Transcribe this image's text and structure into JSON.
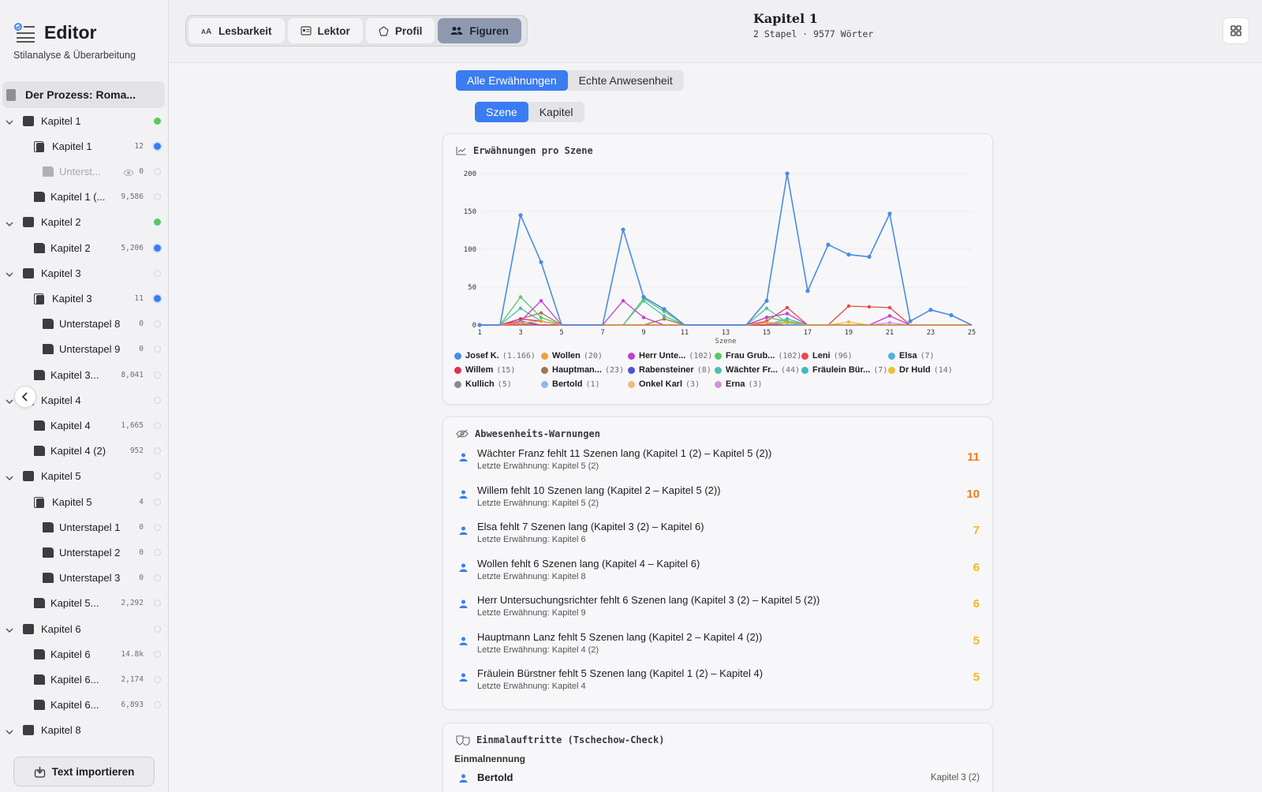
{
  "sidebar": {
    "title": "Editor",
    "subtitle": "Stilanalyse & Überarbeitung",
    "root": "Der Prozess: Roma...",
    "rows": [
      {
        "label": "Kapitel 1",
        "type": "folder",
        "level": 0,
        "count": "",
        "status": "green"
      },
      {
        "label": "Kapitel 1",
        "type": "stack",
        "level": 1,
        "count": "12",
        "status": "blue"
      },
      {
        "label": "Unterst...",
        "type": "subdoc-hidden",
        "level": 2,
        "count": "0",
        "status": "empty"
      },
      {
        "label": "Kapitel 1 (...",
        "type": "doc",
        "level": 1,
        "count": "9,586",
        "status": "empty"
      },
      {
        "label": "Kapitel 2",
        "type": "folder",
        "level": 0,
        "count": "",
        "status": "green"
      },
      {
        "label": "Kapitel 2",
        "type": "doc",
        "level": 1,
        "count": "5,206",
        "status": "blue"
      },
      {
        "label": "Kapitel 3",
        "type": "folder",
        "level": 0,
        "count": "",
        "status": "empty"
      },
      {
        "label": "Kapitel 3",
        "type": "stack",
        "level": 1,
        "count": "11",
        "status": "blue"
      },
      {
        "label": "Unterstapel 8",
        "type": "subdoc",
        "level": 2,
        "count": "0",
        "status": "empty"
      },
      {
        "label": "Unterstapel 9",
        "type": "subdoc",
        "level": 2,
        "count": "0",
        "status": "empty"
      },
      {
        "label": "Kapitel 3...",
        "type": "doc",
        "level": 1,
        "count": "8,041",
        "status": "empty"
      },
      {
        "label": "Kapitel 4",
        "type": "folder",
        "level": 0,
        "count": "",
        "status": "empty"
      },
      {
        "label": "Kapitel 4",
        "type": "doc",
        "level": 1,
        "count": "1,665",
        "status": "empty"
      },
      {
        "label": "Kapitel 4 (2)",
        "type": "doc",
        "level": 1,
        "count": "952",
        "status": "empty"
      },
      {
        "label": "Kapitel 5",
        "type": "folder",
        "level": 0,
        "count": "",
        "status": "empty"
      },
      {
        "label": "Kapitel 5",
        "type": "stack",
        "level": 1,
        "count": "4",
        "status": "empty"
      },
      {
        "label": "Unterstapel 1",
        "type": "subdoc",
        "level": 2,
        "count": "0",
        "status": "empty"
      },
      {
        "label": "Unterstapel 2",
        "type": "subdoc",
        "level": 2,
        "count": "0",
        "status": "empty"
      },
      {
        "label": "Unterstapel 3",
        "type": "subdoc",
        "level": 2,
        "count": "0",
        "status": "empty"
      },
      {
        "label": "Kapitel 5...",
        "type": "doc",
        "level": 1,
        "count": "2,292",
        "status": "empty"
      },
      {
        "label": "Kapitel 6",
        "type": "folder",
        "level": 0,
        "count": "",
        "status": "empty"
      },
      {
        "label": "Kapitel 6",
        "type": "doc",
        "level": 1,
        "count": "14.8k",
        "status": "empty"
      },
      {
        "label": "Kapitel 6...",
        "type": "doc",
        "level": 1,
        "count": "2,174",
        "status": "empty"
      },
      {
        "label": "Kapitel 6...",
        "type": "doc",
        "level": 1,
        "count": "6,893",
        "status": "empty"
      },
      {
        "label": "Kapitel 8",
        "type": "folder",
        "level": 0,
        "count": "",
        "status": "none"
      }
    ],
    "import_label": "Text importieren"
  },
  "topbar": {
    "tabs": [
      {
        "label": "Lesbarkeit",
        "icon": "text-size-icon",
        "active": false
      },
      {
        "label": "Lektor",
        "icon": "id-card-icon",
        "active": false
      },
      {
        "label": "Profil",
        "icon": "pentagon-icon",
        "active": false
      },
      {
        "label": "Figuren",
        "icon": "people-icon",
        "active": true
      }
    ],
    "doc_title": "Kapitel 1",
    "doc_meta": "2 Stapel · 9577 Wörter"
  },
  "filters": {
    "mode": [
      "Alle Erwähnungen",
      "Echte Anwesenheit"
    ],
    "scope": [
      "Szene",
      "Kapitel"
    ]
  },
  "mentions_card": {
    "title": "Erwähnungen pro Szene"
  },
  "chart_data": {
    "type": "line",
    "xlabel": "Szene",
    "ylabel": "",
    "x": [
      1,
      2,
      3,
      4,
      5,
      6,
      7,
      8,
      9,
      10,
      11,
      12,
      13,
      14,
      15,
      16,
      17,
      18,
      19,
      20,
      21,
      22,
      23,
      24,
      25
    ],
    "xticks": [
      1,
      3,
      5,
      7,
      9,
      11,
      13,
      15,
      17,
      19,
      21,
      23,
      25
    ],
    "yticks": [
      0,
      50,
      100,
      150,
      200
    ],
    "ylim": [
      0,
      200
    ],
    "series": [
      {
        "name": "Josef K.",
        "count": "(1.166)",
        "color": "#4a8be6",
        "values": [
          0,
          0,
          145,
          83,
          0,
          0,
          0,
          126,
          37,
          21,
          0,
          0,
          0,
          0,
          32,
          200,
          45,
          106,
          93,
          90,
          147,
          5,
          20,
          13,
          0
        ]
      },
      {
        "name": "Wollen",
        "count": "(20)",
        "color": "#f0a040",
        "values": [
          0,
          0,
          3,
          5,
          0,
          0,
          0,
          0,
          0,
          0,
          0,
          0,
          0,
          0,
          3,
          3,
          0,
          0,
          0,
          0,
          0,
          0,
          0,
          0,
          0
        ]
      },
      {
        "name": "Herr Unte...",
        "count": "(102)",
        "color": "#c040d0",
        "values": [
          0,
          0,
          5,
          32,
          0,
          0,
          0,
          32,
          10,
          0,
          0,
          0,
          0,
          0,
          10,
          15,
          0,
          0,
          0,
          0,
          12,
          0,
          0,
          0,
          0
        ]
      },
      {
        "name": "Frau Grub...",
        "count": "(102)",
        "color": "#5ac864",
        "values": [
          0,
          0,
          37,
          10,
          0,
          0,
          0,
          0,
          35,
          18,
          0,
          0,
          0,
          0,
          10,
          5,
          0,
          0,
          0,
          0,
          0,
          0,
          0,
          0,
          0
        ]
      },
      {
        "name": "Leni",
        "count": "(96)",
        "color": "#e84848",
        "values": [
          0,
          0,
          0,
          0,
          0,
          0,
          0,
          0,
          0,
          0,
          0,
          0,
          0,
          0,
          5,
          23,
          0,
          0,
          25,
          24,
          23,
          0,
          0,
          0,
          0
        ]
      },
      {
        "name": "Elsa",
        "count": "(7)",
        "color": "#50b0e0",
        "values": [
          0,
          0,
          0,
          0,
          0,
          0,
          0,
          0,
          0,
          0,
          0,
          0,
          0,
          0,
          3,
          0,
          0,
          0,
          0,
          0,
          0,
          0,
          0,
          0,
          0
        ]
      },
      {
        "name": "Willem",
        "count": "(15)",
        "color": "#e03050",
        "values": [
          0,
          0,
          8,
          5,
          0,
          0,
          0,
          0,
          0,
          0,
          0,
          0,
          0,
          0,
          0,
          0,
          0,
          0,
          0,
          0,
          0,
          0,
          0,
          0,
          0
        ]
      },
      {
        "name": "Hauptman...",
        "count": "(23)",
        "color": "#a07850",
        "values": [
          0,
          0,
          8,
          16,
          0,
          0,
          0,
          0,
          0,
          8,
          0,
          0,
          0,
          0,
          0,
          0,
          0,
          0,
          0,
          0,
          0,
          0,
          0,
          0,
          0
        ]
      },
      {
        "name": "Rabensteiner",
        "count": "(8)",
        "color": "#5050d0",
        "values": [
          0,
          0,
          5,
          0,
          0,
          0,
          0,
          0,
          0,
          0,
          0,
          0,
          0,
          0,
          0,
          0,
          0,
          0,
          0,
          0,
          0,
          0,
          0,
          0,
          0
        ]
      },
      {
        "name": "Wächter Fr...",
        "count": "(44)",
        "color": "#50c0a8",
        "values": [
          0,
          0,
          22,
          5,
          0,
          0,
          0,
          0,
          32,
          12,
          0,
          0,
          0,
          0,
          22,
          3,
          0,
          0,
          0,
          0,
          0,
          0,
          0,
          0,
          0
        ]
      },
      {
        "name": "Fräulein Bür...",
        "count": "(7)",
        "color": "#40b8c8",
        "values": [
          0,
          0,
          0,
          0,
          0,
          0,
          0,
          0,
          0,
          0,
          0,
          0,
          0,
          0,
          0,
          8,
          0,
          0,
          0,
          0,
          0,
          0,
          0,
          0,
          0
        ]
      },
      {
        "name": "Dr Huld",
        "count": "(14)",
        "color": "#f0c030",
        "values": [
          0,
          0,
          0,
          0,
          0,
          0,
          0,
          0,
          0,
          0,
          0,
          0,
          0,
          0,
          0,
          5,
          0,
          0,
          4,
          0,
          0,
          0,
          0,
          0,
          0
        ]
      },
      {
        "name": "Kullich",
        "count": "(5)",
        "color": "#8a8a8e",
        "values": [
          0,
          0,
          2,
          0,
          0,
          0,
          0,
          0,
          0,
          0,
          0,
          0,
          0,
          0,
          0,
          0,
          0,
          0,
          0,
          0,
          0,
          0,
          0,
          0,
          0
        ]
      },
      {
        "name": "Bertold",
        "count": "(1)",
        "color": "#90b8f0",
        "values": [
          0,
          0,
          0,
          0,
          0,
          0,
          0,
          0,
          0,
          0,
          0,
          0,
          0,
          0,
          0,
          0,
          0,
          0,
          0,
          0,
          0,
          0,
          0,
          0,
          0
        ]
      },
      {
        "name": "Onkel Karl",
        "count": "(3)",
        "color": "#f0b880",
        "values": [
          0,
          0,
          0,
          0,
          0,
          0,
          0,
          0,
          0,
          0,
          0,
          0,
          0,
          0,
          0,
          3,
          0,
          0,
          0,
          0,
          0,
          0,
          0,
          0,
          0
        ]
      },
      {
        "name": "Erna",
        "count": "(3)",
        "color": "#d890e0",
        "values": [
          0,
          0,
          0,
          0,
          0,
          0,
          0,
          0,
          0,
          0,
          0,
          0,
          0,
          0,
          0,
          0,
          0,
          0,
          0,
          0,
          3,
          0,
          0,
          0,
          0
        ]
      }
    ]
  },
  "warnings_card": {
    "title": "Abwesenheits-Warnungen",
    "items": [
      {
        "text": "Wächter Franz fehlt 11 Szenen lang (Kapitel 1 (2) – Kapitel 5 (2))",
        "last": "Letzte Erwähnung: Kapitel 5 (2)",
        "num": "11",
        "color": "#f07d20"
      },
      {
        "text": "Willem fehlt 10 Szenen lang (Kapitel 2 – Kapitel 5 (2))",
        "last": "Letzte Erwähnung: Kapitel 5 (2)",
        "num": "10",
        "color": "#f07d20"
      },
      {
        "text": "Elsa fehlt 7 Szenen lang (Kapitel 3 (2) – Kapitel 6)",
        "last": "Letzte Erwähnung: Kapitel 6",
        "num": "7",
        "color": "#f5b820"
      },
      {
        "text": "Wollen fehlt 6 Szenen lang (Kapitel 4 – Kapitel 6)",
        "last": "Letzte Erwähnung: Kapitel 8",
        "num": "6",
        "color": "#f5b820"
      },
      {
        "text": "Herr Untersuchungsrichter fehlt 6 Szenen lang (Kapitel 3 (2) – Kapitel 5 (2))",
        "last": "Letzte Erwähnung: Kapitel 9",
        "num": "6",
        "color": "#f5b820"
      },
      {
        "text": "Hauptmann Lanz fehlt 5 Szenen lang (Kapitel 2 – Kapitel 4 (2))",
        "last": "Letzte Erwähnung: Kapitel 4 (2)",
        "num": "5",
        "color": "#f5b820"
      },
      {
        "text": "Fräulein Bürstner fehlt 5 Szenen lang (Kapitel 1 (2) – Kapitel 4)",
        "last": "Letzte Erwähnung: Kapitel 4",
        "num": "5",
        "color": "#f5b820"
      }
    ]
  },
  "single_card": {
    "title": "Einmalauftritte (Tschechow-Check)",
    "subtitle": "Einmalnennung",
    "items": [
      {
        "name": "Bertold",
        "where": "Kapitel 3 (2)"
      }
    ]
  }
}
